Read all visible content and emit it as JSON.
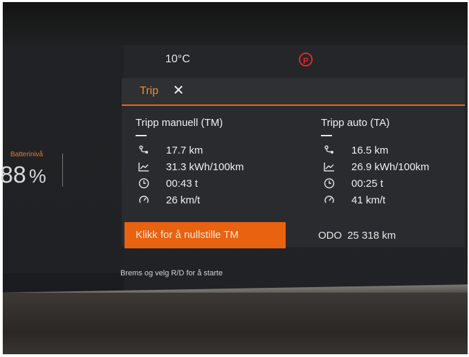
{
  "status_bar": {
    "temperature": "10°C",
    "park_brake_symbol": "P",
    "park_brake_color": "#e2262a"
  },
  "battery": {
    "label": "Batterinivå",
    "value": "88",
    "unit": "%"
  },
  "panel": {
    "title": "Trip",
    "close_symbol": "✕",
    "accent_color": "#e86a1a",
    "left": {
      "title": "Tripp manuell (TM)",
      "rows": [
        {
          "icon": "distance-icon",
          "value": "17.7 km"
        },
        {
          "icon": "consumption-icon",
          "value": "31.3 kWh/100km"
        },
        {
          "icon": "clock-icon",
          "value": "00:43 t"
        },
        {
          "icon": "speed-icon",
          "value": "26 km/t"
        }
      ]
    },
    "right": {
      "title": "Tripp auto (TA)",
      "rows": [
        {
          "icon": "distance-icon",
          "value": "16.5 km"
        },
        {
          "icon": "consumption-icon",
          "value": "26.9 kWh/100km"
        },
        {
          "icon": "clock-icon",
          "value": "00:25 t"
        },
        {
          "icon": "speed-icon",
          "value": "41 km/t"
        }
      ]
    },
    "reset_button": "Klikk for å nullstille TM",
    "odo_label": "ODO",
    "odo_value": "25 318 km"
  },
  "hint": "Brems og velg R/D for å starte"
}
